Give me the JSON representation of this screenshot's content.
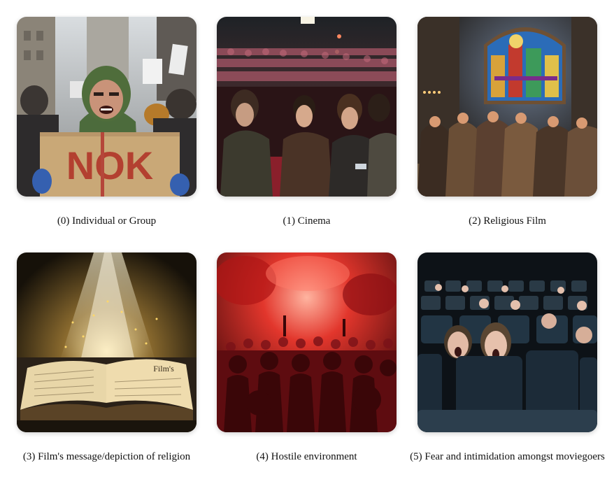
{
  "panels": [
    {
      "label": "(0) Individual or Group",
      "image": "angry-protester-photo",
      "sign_text": "NOK"
    },
    {
      "label": "(1) Cinema",
      "image": "cinema-audience-photo"
    },
    {
      "label": "(2) Religious Film",
      "image": "stained-glass-congregation-photo"
    },
    {
      "label": "(3) Film's message/depiction of religion",
      "image": "glowing-open-book-photo",
      "book_text": "Film's"
    },
    {
      "label": "(4) Hostile environment",
      "image": "red-smoke-crowd-photo"
    },
    {
      "label": "(5) Fear and intimidation amongst moviegoers",
      "image": "frightened-moviegoers-photo"
    }
  ]
}
